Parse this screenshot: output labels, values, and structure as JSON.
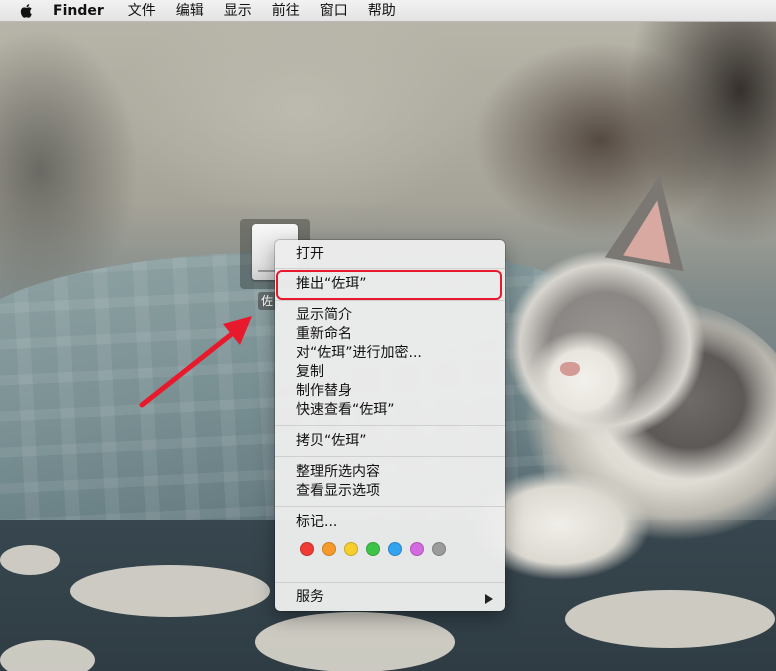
{
  "menubar": {
    "app_name": "Finder",
    "items": [
      "文件",
      "编辑",
      "显示",
      "前往",
      "窗口",
      "帮助"
    ]
  },
  "desktop": {
    "drive_label": "佐"
  },
  "context_menu": {
    "items": [
      {
        "label": "打开"
      },
      {
        "label": "推出“佐珥”"
      },
      {
        "label": "显示简介"
      },
      {
        "label": "重新命名"
      },
      {
        "label": "对“佐珥”进行加密..."
      },
      {
        "label": "复制"
      },
      {
        "label": "制作替身"
      },
      {
        "label": "快速查看“佐珥”"
      },
      {
        "label": "拷贝“佐珥”"
      },
      {
        "label": "整理所选内容"
      },
      {
        "label": "查看显示选项"
      },
      {
        "label": "标记..."
      },
      {
        "label": "服务"
      }
    ],
    "tag_colors": [
      "#f03a35",
      "#f79a2c",
      "#f6cf2e",
      "#3dc448",
      "#33a2ef",
      "#d46ae0",
      "#9b9b9b"
    ]
  },
  "annotation": {
    "highlight_color": "#e8192c",
    "arrow_color": "#e8192c"
  }
}
